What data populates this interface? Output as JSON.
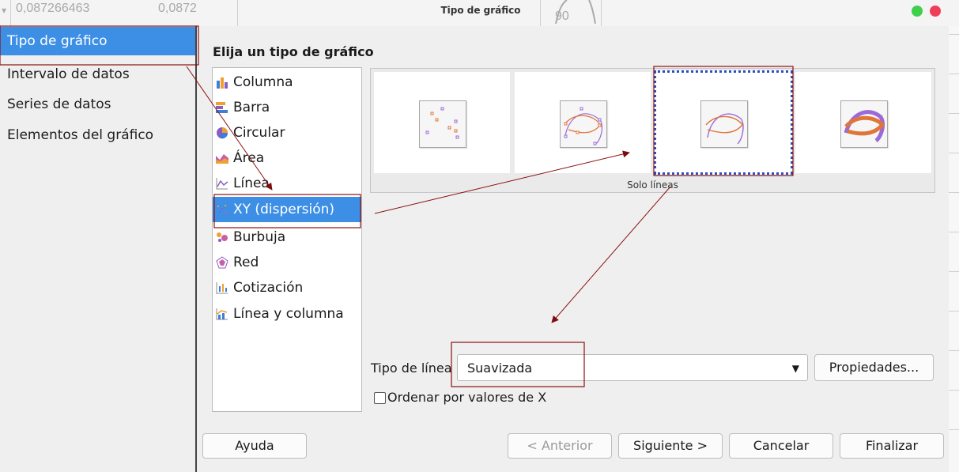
{
  "background": {
    "cell_values": [
      "0,087266463",
      "0,0872",
      "90"
    ]
  },
  "window": {
    "title": "Tipo de gráfico",
    "controls": [
      "green-dot",
      "red-dot"
    ]
  },
  "sidebar": {
    "items": [
      {
        "label": "Tipo de gráfico",
        "selected": true
      },
      {
        "label": "Intervalo de datos"
      },
      {
        "label": "Series de datos"
      },
      {
        "label": "Elementos del gráfico"
      }
    ]
  },
  "main": {
    "heading": "Elija un tipo de gráfico",
    "chart_types": [
      {
        "label": "Columna",
        "icon": "column-chart-icon"
      },
      {
        "label": "Barra",
        "icon": "bar-chart-icon"
      },
      {
        "label": "Circular",
        "icon": "pie-chart-icon"
      },
      {
        "label": "Área",
        "icon": "area-chart-icon"
      },
      {
        "label": "Línea",
        "icon": "line-chart-icon"
      },
      {
        "label": "XY (dispersión)",
        "icon": "scatter-chart-icon",
        "selected": true
      },
      {
        "label": "Burbuja",
        "icon": "bubble-chart-icon"
      },
      {
        "label": "Red",
        "icon": "net-chart-icon"
      },
      {
        "label": "Cotización",
        "icon": "stock-chart-icon"
      },
      {
        "label": "Línea y columna",
        "icon": "column-line-chart-icon"
      }
    ],
    "variants": {
      "selected_caption": "Solo líneas",
      "items": [
        {
          "icon": "points-only-icon"
        },
        {
          "icon": "points-and-lines-icon"
        },
        {
          "icon": "lines-only-icon",
          "selected": true
        },
        {
          "icon": "3d-lines-icon"
        }
      ]
    },
    "line_type": {
      "label": "Tipo de línea",
      "value": "Suavizada",
      "properties_button": "Propiedades..."
    },
    "sort_checkbox": {
      "label": "Ordenar por valores de X",
      "checked": false
    }
  },
  "footer": {
    "help": "Ayuda",
    "back": "< Anterior",
    "next": "Siguiente >",
    "cancel": "Cancelar",
    "finish": "Finalizar"
  },
  "colors": {
    "selection": "#3d8fe6",
    "annotation": "#8b1010"
  }
}
